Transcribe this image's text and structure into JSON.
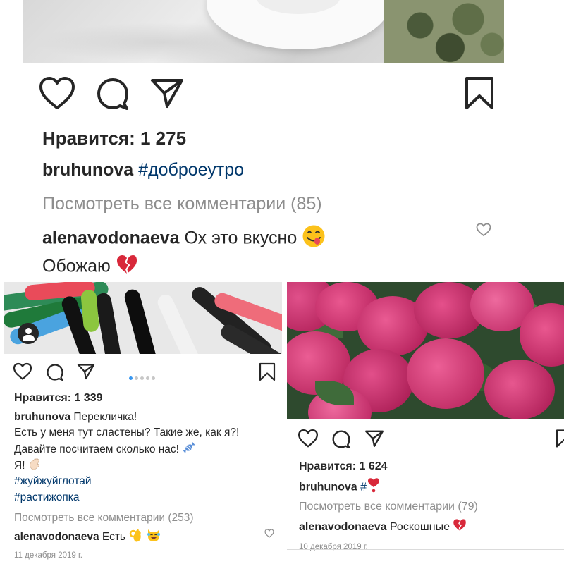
{
  "top_post": {
    "likes_text": "Нравится: 1 275",
    "caption_user": "bruhunova",
    "caption_hashtag": "#доброеутро",
    "view_comments": "Посмотреть все комментарии (85)",
    "comment_user": "alenavodonaeva",
    "comment_text": "Ох это вкусно",
    "comment_emoji": "face-savoring-food-emoji",
    "comment_line2": "Обожаю",
    "comment_line2_emoji": "broken-heart-emoji"
  },
  "bottom_left_post": {
    "likes_text": "Нравится: 1 339",
    "caption_user": "bruhunova",
    "caption_line1": "Перекличка!",
    "caption_line2": "Есть у меня тут сластены? Такие же, как я?!",
    "caption_line3": "Давайте посчитаем сколько нас!",
    "caption_line3_emoji": "candy-emoji",
    "caption_line4": "Я!",
    "caption_line4_emoji": "waving-hand-emoji",
    "hashtag1": "#жуйжуйглотай",
    "hashtag2": "#растижопка",
    "view_comments": "Посмотреть все комментарии (253)",
    "comment_user": "alenavodonaeva",
    "comment_text": "Есть",
    "comment_emojis": [
      "ok-hand-emoji",
      "smiling-cat-emoji"
    ],
    "date": "11 декабря 2019 г.",
    "carousel_count": 5,
    "carousel_active": 0
  },
  "bottom_right_post": {
    "likes_text": "Нравится: 1 624",
    "caption_user": "bruhunova",
    "caption_hashtag": "#",
    "caption_emoji": "heart-exclamation-emoji",
    "view_comments": "Посмотреть все комментарии (79)",
    "comment_user": "alenavodonaeva",
    "comment_text": "Роскошные",
    "comment_emoji": "broken-heart-emoji",
    "date": "10 декабря 2019 г."
  },
  "colors": {
    "text": "#262626",
    "muted": "#8e8e8e",
    "hashtag": "#00376b",
    "carousel_active": "#3897f0",
    "carousel_inactive": "#c7c7c7",
    "heart_red": "#d8283a"
  }
}
